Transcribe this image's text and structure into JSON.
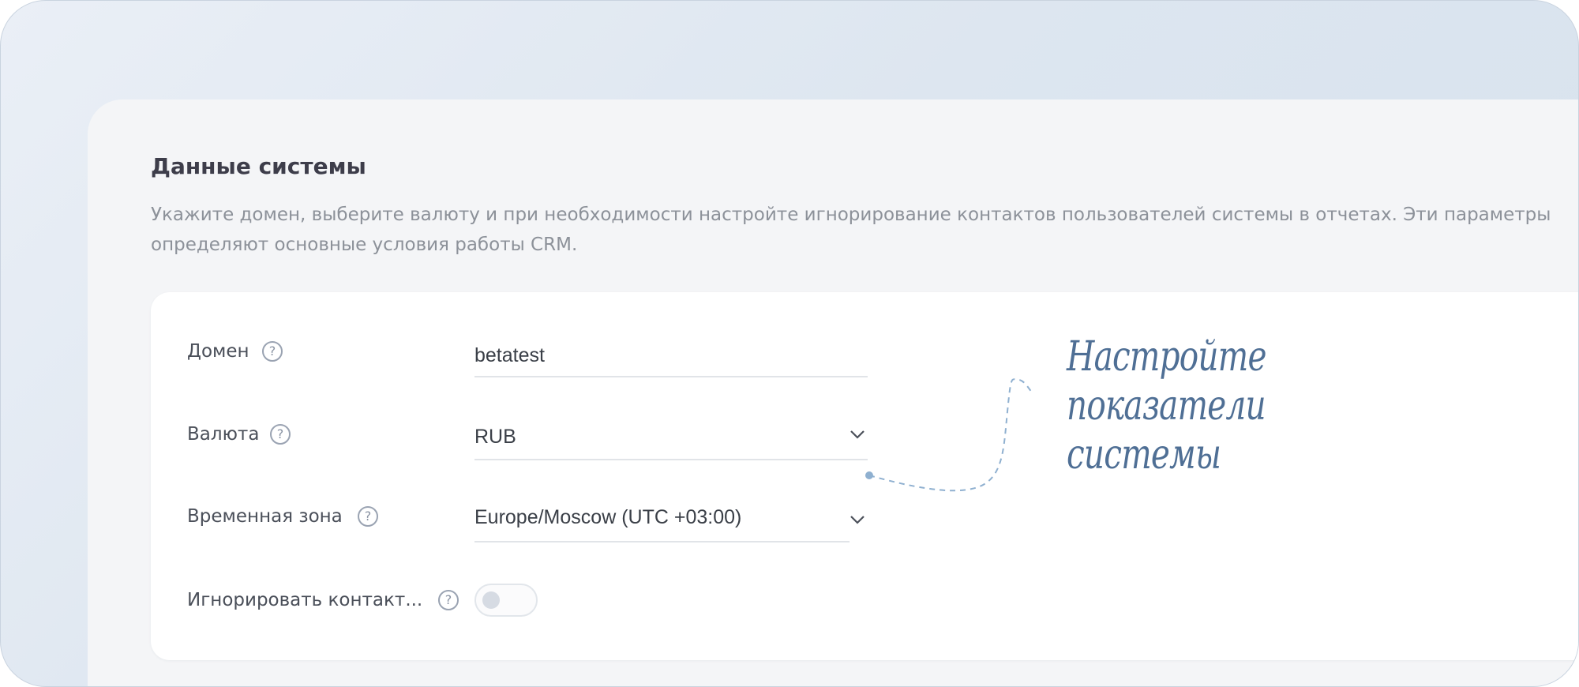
{
  "section": {
    "title": "Данные системы",
    "description": "Укажите домен, выберите валюту и при необходимости настройте игнорирование контактов пользователей системы в отчетах. Эти параметры определяют основные условия работы CRM."
  },
  "form": {
    "domain": {
      "label": "Домен",
      "value": "betatest",
      "help_icon": "question-circle-icon"
    },
    "currency": {
      "label": "Валюта",
      "value": "RUB",
      "help_icon": "question-circle-icon",
      "dropdown_icon": "chevron-down-icon"
    },
    "timezone": {
      "label": "Временная зона",
      "value": "Europe/Moscow (UTC +03:00)",
      "help_icon": "question-circle-icon",
      "dropdown_icon": "chevron-down-icon"
    },
    "ignore_contacts": {
      "label": "Игнорировать контакт...",
      "help_icon": "question-circle-icon",
      "enabled": false
    }
  },
  "help_glyph": "?",
  "annotation": {
    "line1": "Настройте показатели",
    "line2": "системы"
  },
  "colors": {
    "annotation": "#4f6f95",
    "help_icon": "#9aa3b2",
    "panel": "#f4f5f7",
    "card": "#ffffff"
  }
}
